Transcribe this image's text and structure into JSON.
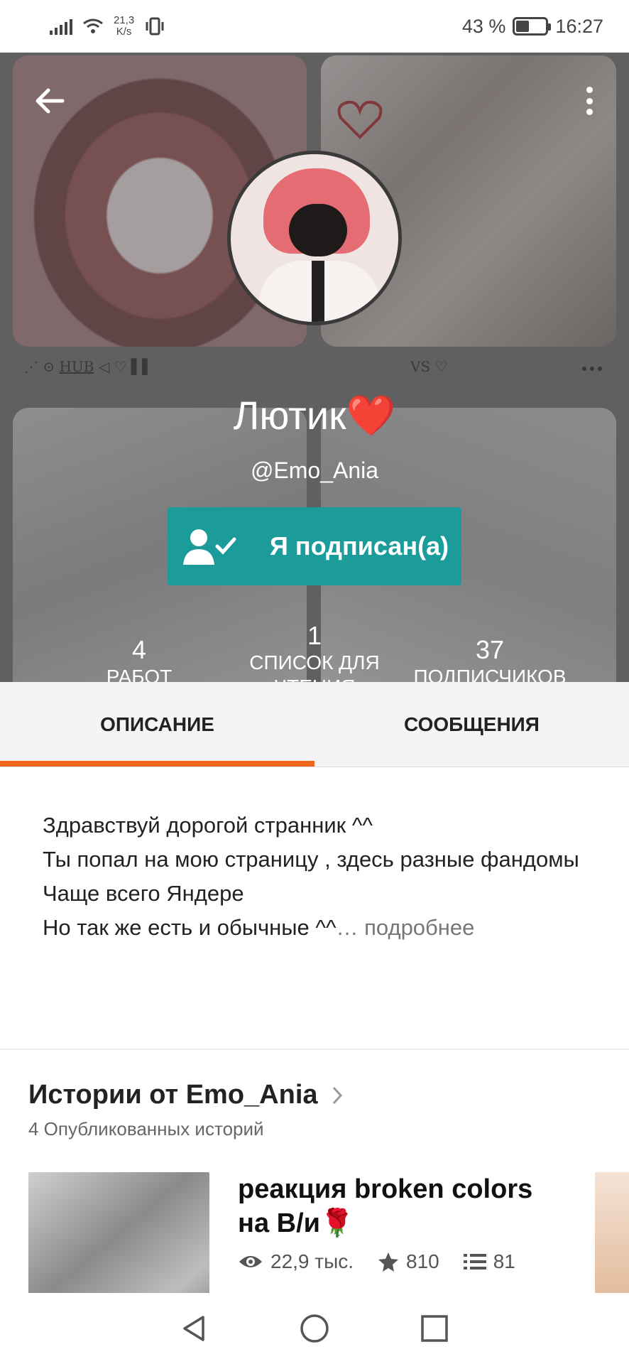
{
  "status_bar": {
    "net_speed_value": "21,3",
    "net_speed_unit": "K/s",
    "battery_percent": "43 %",
    "battery_level": 0.43,
    "time": "16:27"
  },
  "header": {
    "tile_caption_left": "HUB",
    "tile_caption_right": "VS",
    "profile_name": "Лютик❤️",
    "handle": "@Emo_Ania",
    "follow_label": "Я подписан(а)"
  },
  "stats": [
    {
      "value": "4",
      "label": "РАБОТ"
    },
    {
      "value": "1",
      "label": "СПИСОК ДЛЯ ЧТЕНИЯ"
    },
    {
      "value": "37",
      "label": "ПОДПИСЧИКОВ"
    }
  ],
  "tabs": [
    {
      "label": "ОПИСАНИЕ",
      "active": true
    },
    {
      "label": "СООБЩЕНИЯ",
      "active": false
    }
  ],
  "description": {
    "lines": [
      "Здравствуй дорогой странник ^^",
      "Ты попал на мою страницу , здесь разные фандомы",
      "Чаще всего Яндере",
      "Но так же есть и обычные ^^"
    ],
    "more_label": "… подробнее"
  },
  "stories": {
    "title": "Истории от Emo_Ania",
    "subtitle": "4 Опубликованных историй",
    "items": [
      {
        "title": "реакция broken colors на В/и🌹",
        "views": "22,9 тыс.",
        "votes": "810",
        "parts": "81"
      }
    ]
  },
  "colors": {
    "accent": "#f0641c",
    "follow_button": "#1c9b9b"
  }
}
